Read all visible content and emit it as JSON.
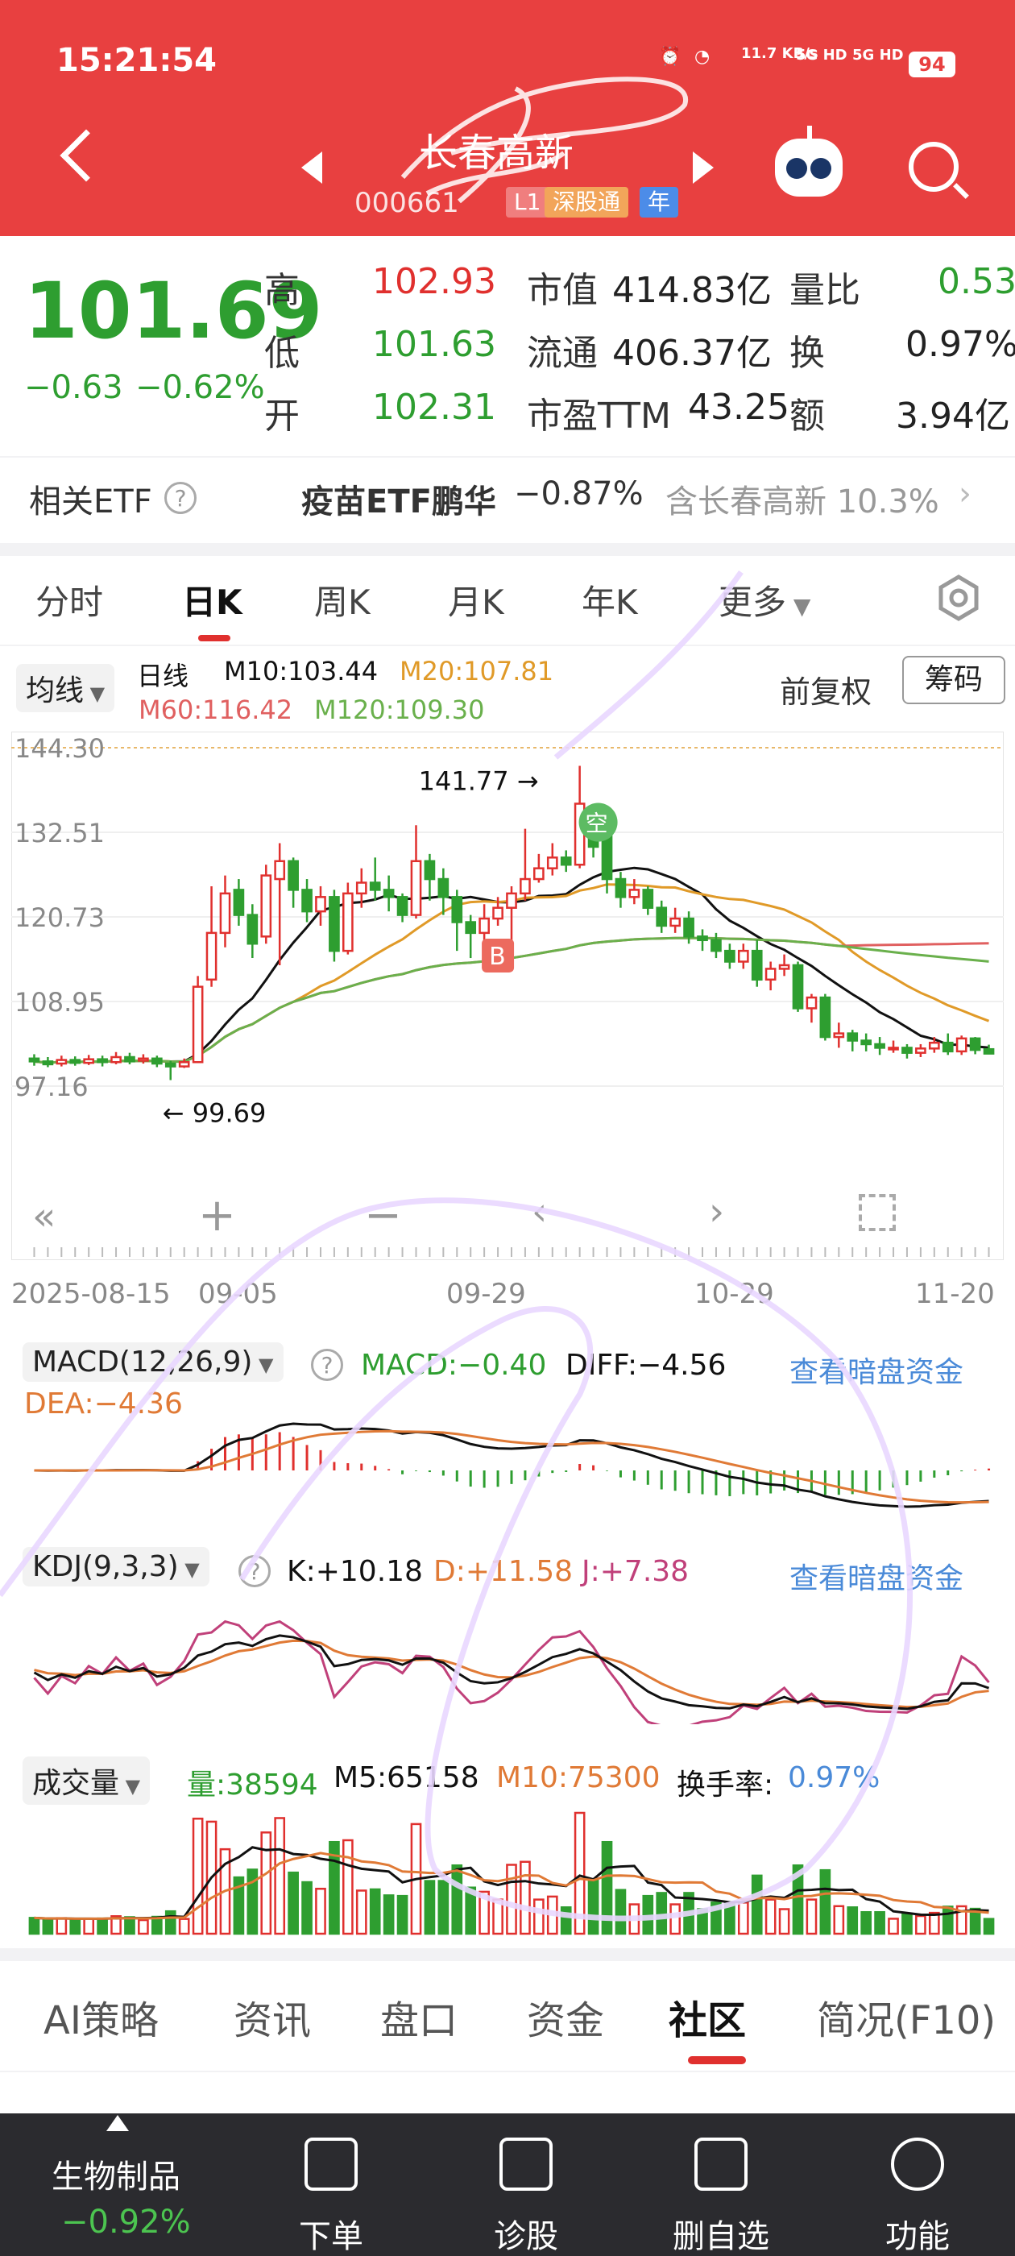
{
  "status": {
    "time": "15:21:54",
    "net": "11.7 KB/s",
    "sig1": "5G HD",
    "sig2": "5G HD",
    "battery": "94"
  },
  "header": {
    "name": "长春高新",
    "code": "000661",
    "tag1": "L1",
    "tag2": "深股通",
    "tag3": "年"
  },
  "quote": {
    "price": "101.69",
    "change": "−0.63",
    "change_pct": "−0.62%",
    "rows": [
      {
        "l1": "高",
        "v1": "102.93",
        "l2": "市值",
        "v2": "414.83亿",
        "l3": "量比",
        "v3": "0.53"
      },
      {
        "l1": "低",
        "v1": "101.63",
        "l2": "流通",
        "v2": "406.37亿",
        "l3": "换",
        "v3": "0.97%"
      },
      {
        "l1": "开",
        "v1": "102.31",
        "l2": "市盈TTM",
        "v2": "43.25",
        "l3": "额",
        "v3": "3.94亿"
      }
    ]
  },
  "etf": {
    "label": "相关ETF",
    "name": "疫苗ETF鹏华",
    "pct": "−0.87%",
    "hold": "含长春高新 10.3%"
  },
  "tabs": [
    "分时",
    "日K",
    "周K",
    "月K",
    "年K",
    "更多"
  ],
  "legend": {
    "ma_select": "均线",
    "period": "日线",
    "m10": "M10:103.44",
    "m20": "M20:107.81",
    "m60": "M60:116.42",
    "m120": "M120:109.30",
    "adjust": "前复权",
    "chips": "筹码"
  },
  "chart_data": {
    "type": "candlestick",
    "title": "日线",
    "y_ticks": [
      "144.30",
      "132.51",
      "120.73",
      "108.95",
      "97.16"
    ],
    "ylim": [
      97.16,
      144.3
    ],
    "x_ticks": [
      "2025-08-15",
      "09-05",
      "09-29",
      "10-29",
      "11-20"
    ],
    "high_label": "141.77",
    "low_label": "99.69",
    "buy_marker": "B",
    "empty_marker": "空",
    "ma_series": [
      {
        "name": "M10",
        "color": "#111111"
      },
      {
        "name": "M20",
        "color": "#e09a28"
      },
      {
        "name": "M60",
        "color": "#e06060"
      },
      {
        "name": "M120",
        "color": "#6ab04c"
      }
    ],
    "candles": [
      [
        101.0,
        100.6,
        101.6,
        100.0
      ],
      [
        100.6,
        100.2,
        101.2,
        99.8
      ],
      [
        100.3,
        100.8,
        101.4,
        99.9
      ],
      [
        100.8,
        100.4,
        101.3,
        100.0
      ],
      [
        100.4,
        100.9,
        101.5,
        100.1
      ],
      [
        100.9,
        100.5,
        101.4,
        99.9
      ],
      [
        100.5,
        101.2,
        101.9,
        100.2
      ],
      [
        101.2,
        100.6,
        101.8,
        100.2
      ],
      [
        100.7,
        101.0,
        101.6,
        100.3
      ],
      [
        101.0,
        100.3,
        101.4,
        99.8
      ],
      [
        100.3,
        99.9,
        100.7,
        98.0
      ],
      [
        99.9,
        100.5,
        101.0,
        99.69
      ],
      [
        100.5,
        111.0,
        112.5,
        100.4
      ],
      [
        112.0,
        118.5,
        125.0,
        111.0
      ],
      [
        118.5,
        124.0,
        126.5,
        116.5
      ],
      [
        124.5,
        121.0,
        126.0,
        119.5
      ],
      [
        121.0,
        117.0,
        122.5,
        115.0
      ],
      [
        118.0,
        126.5,
        128.0,
        117.0
      ],
      [
        126.0,
        128.5,
        131.0,
        114.0
      ],
      [
        128.5,
        124.5,
        129.0,
        122.0
      ],
      [
        124.5,
        121.5,
        126.0,
        120.0
      ],
      [
        121.5,
        123.5,
        125.0,
        119.5
      ],
      [
        123.5,
        116.0,
        124.5,
        114.5
      ],
      [
        116.0,
        124.0,
        125.5,
        115.5
      ],
      [
        124.0,
        125.5,
        127.5,
        122.0
      ],
      [
        125.5,
        124.5,
        129.0,
        123.0
      ],
      [
        124.5,
        123.5,
        126.5,
        121.5
      ],
      [
        123.5,
        121.0,
        124.0,
        120.0
      ],
      [
        121.0,
        128.5,
        133.5,
        120.5
      ],
      [
        128.5,
        126.0,
        129.5,
        123.0
      ],
      [
        126.0,
        123.5,
        127.5,
        121.0
      ],
      [
        123.5,
        120.0,
        124.5,
        116.0
      ],
      [
        120.0,
        118.5,
        121.0,
        115.0
      ],
      [
        118.5,
        120.5,
        122.5,
        117.5
      ],
      [
        120.5,
        122.0,
        123.5,
        119.5
      ],
      [
        122.0,
        124.0,
        125.0,
        115.5
      ],
      [
        124.0,
        126.0,
        133.0,
        123.0
      ],
      [
        126.0,
        127.5,
        129.5,
        125.5
      ],
      [
        127.5,
        129.0,
        131.0,
        126.5
      ],
      [
        129.0,
        128.0,
        130.0,
        127.0
      ],
      [
        128.0,
        136.5,
        141.77,
        127.5
      ],
      [
        134.0,
        130.5,
        135.0,
        129.0
      ],
      [
        133.5,
        126.0,
        134.0,
        124.0
      ],
      [
        126.0,
        123.5,
        127.0,
        122.0
      ],
      [
        123.5,
        124.5,
        126.0,
        122.5
      ],
      [
        124.5,
        122.0,
        125.0,
        121.0
      ],
      [
        122.0,
        119.5,
        123.0,
        118.5
      ],
      [
        119.5,
        120.5,
        122.0,
        118.5
      ],
      [
        120.5,
        118.0,
        121.5,
        117.0
      ],
      [
        118.0,
        117.5,
        119.0,
        116.0
      ],
      [
        117.5,
        116.0,
        118.5,
        115.0
      ],
      [
        116.0,
        114.5,
        117.0,
        113.5
      ],
      [
        114.5,
        116.0,
        117.0,
        113.5
      ],
      [
        116.0,
        112.0,
        117.5,
        111.0
      ],
      [
        112.0,
        113.5,
        114.5,
        110.5
      ],
      [
        113.5,
        114.0,
        115.5,
        112.5
      ],
      [
        114.0,
        108.0,
        114.5,
        107.5
      ],
      [
        108.0,
        109.5,
        110.0,
        106.0
      ],
      [
        109.5,
        104.0,
        110.0,
        103.5
      ],
      [
        104.0,
        104.5,
        106.0,
        102.5
      ],
      [
        104.5,
        103.5,
        105.0,
        102.0
      ],
      [
        103.5,
        103.0,
        104.5,
        102.0
      ],
      [
        103.0,
        102.5,
        104.0,
        101.5
      ],
      [
        102.5,
        102.5,
        103.5,
        101.8
      ],
      [
        102.5,
        101.8,
        103.0,
        101.0
      ],
      [
        101.8,
        102.4,
        103.0,
        101.2
      ],
      [
        102.4,
        103.2,
        104.0,
        101.8
      ],
      [
        103.2,
        102.0,
        104.5,
        101.5
      ],
      [
        102.0,
        103.8,
        104.2,
        101.5
      ],
      [
        103.8,
        102.2,
        104.0,
        101.6
      ],
      [
        102.3,
        101.69,
        102.93,
        101.63
      ]
    ]
  },
  "macd": {
    "name": "MACD(12,26,9)",
    "macd": "MACD:−0.40",
    "diff": "DIFF:−4.56",
    "dea": "DEA:−4.36",
    "link": "查看暗盘资金"
  },
  "kdj": {
    "name": "KDJ(9,3,3)",
    "k": "K:+10.18",
    "d": "D:+11.58",
    "j": "J:+7.38",
    "link": "查看暗盘资金"
  },
  "vol": {
    "name": "成交量",
    "vol": "量:38594",
    "m5": "M5:65158",
    "m10": "M10:75300",
    "turn_label": "换手率:",
    "turn": "0.97%"
  },
  "bottom_tabs": [
    "AI策略",
    "资讯",
    "盘口",
    "资金",
    "社区",
    "简况(F10)"
  ],
  "footer": {
    "sector": "生物制品",
    "sector_pct": "−0.92%",
    "items": [
      "下单",
      "诊股",
      "删自选",
      "功能"
    ]
  },
  "colors": {
    "header": "#e84040",
    "up": "#e0302e",
    "down": "#2e9e30",
    "orange": "#e09a28"
  }
}
